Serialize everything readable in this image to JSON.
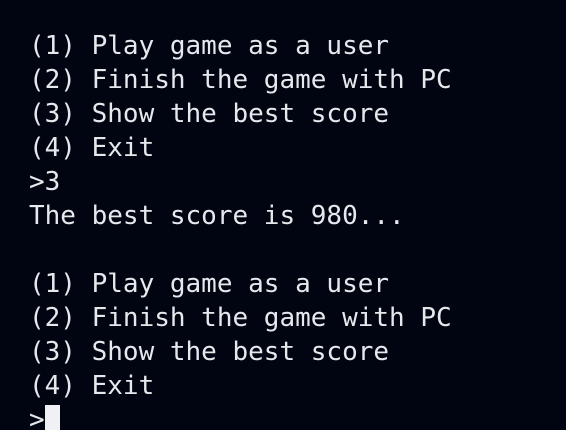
{
  "menu_first": [
    "(1) Play game as a user",
    "(2) Finish the game with PC",
    "(3) Show the best score",
    "(4) Exit"
  ],
  "user_input": ">3",
  "output": "The best score is 980...",
  "menu_second": [
    "(1) Play game as a user",
    "(2) Finish the game with PC",
    "(3) Show the best score",
    "(4) Exit"
  ],
  "prompt": ">",
  "colors": {
    "background": "#010512",
    "text": "#e6e8ec",
    "cursor": "#f0f1f4"
  }
}
